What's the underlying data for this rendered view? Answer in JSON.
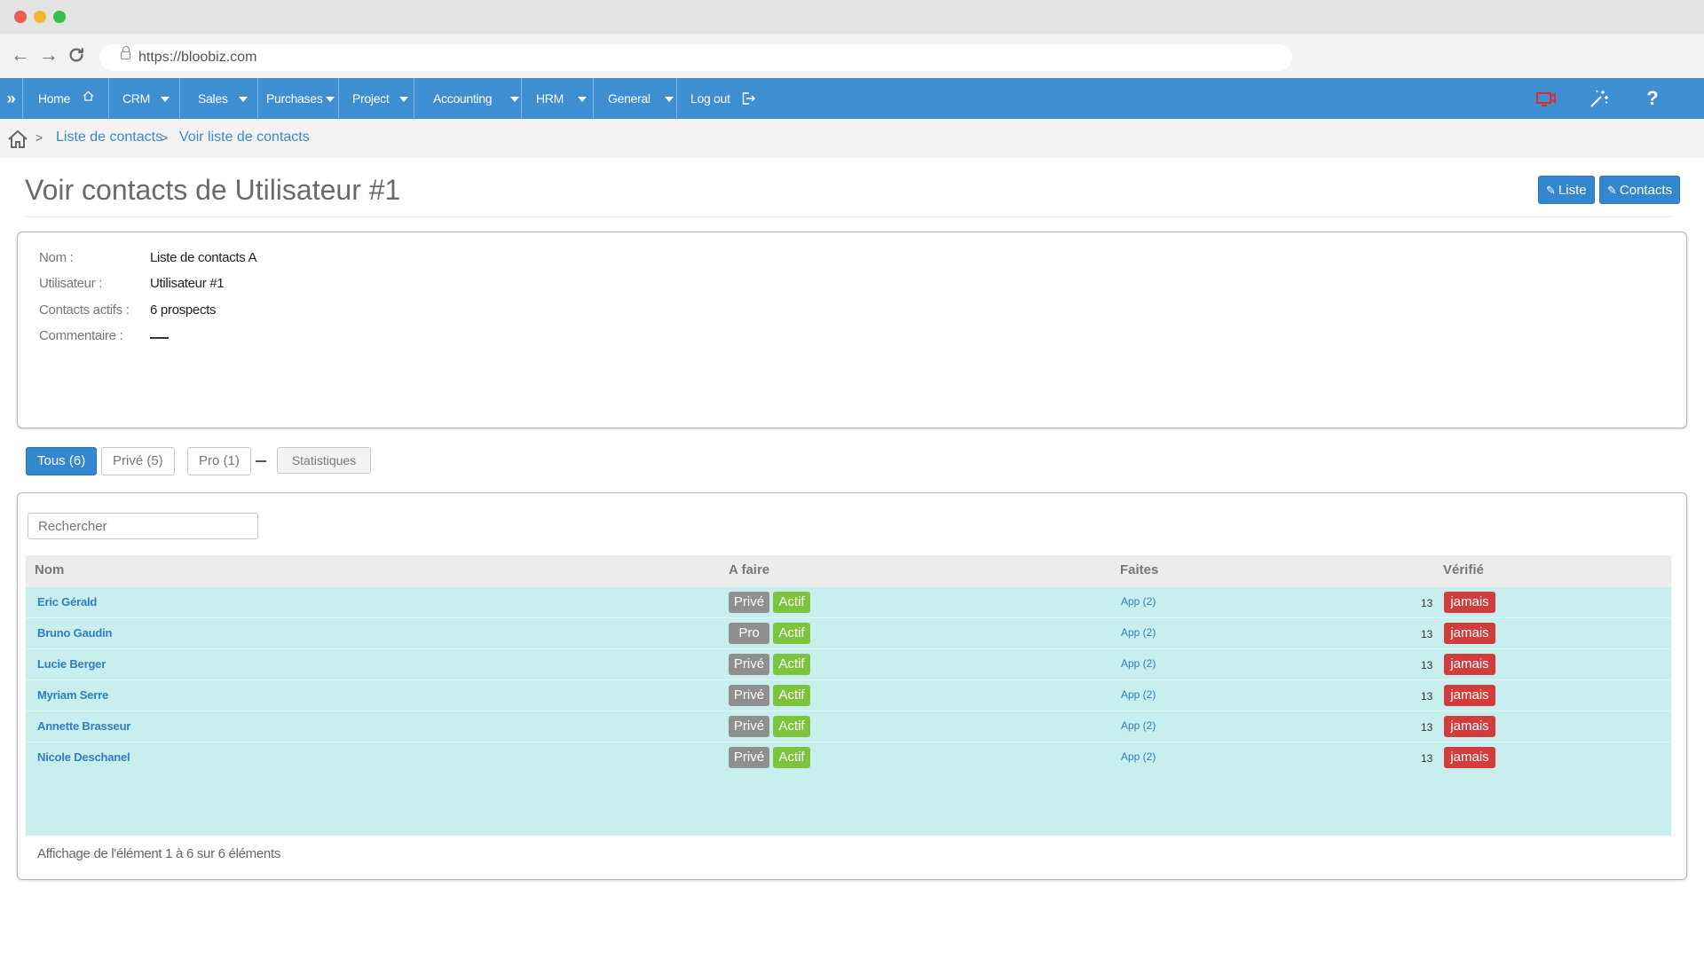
{
  "browser": {
    "url": "https://bloobiz.com"
  },
  "nav": {
    "items": [
      {
        "label": "Home"
      },
      {
        "label": "CRM"
      },
      {
        "label": "Sales"
      },
      {
        "label": "Purchases"
      },
      {
        "label": "Project"
      },
      {
        "label": "Accounting"
      },
      {
        "label": "HRM"
      },
      {
        "label": "General"
      },
      {
        "label": "Log out"
      }
    ],
    "expand_icon": "»",
    "help_label": "?"
  },
  "breadcrumb": {
    "items": [
      "Liste de contacts",
      "Voir liste de contacts"
    ]
  },
  "page": {
    "title": "Voir contacts de Utilisateur #1",
    "buttons": {
      "list_label": "Liste",
      "contacts_label": "Contacts"
    }
  },
  "info": {
    "name_label": "Nom :",
    "name_value": "Liste de contacts A",
    "user_label": "Utilisateur :",
    "user_value": "Utilisateur #1",
    "active_label": "Contacts actifs :",
    "active_value": "6 prospects",
    "comment_label": "Commentaire :"
  },
  "tabs": {
    "all": "Tous (6)",
    "private": "Privé (5)",
    "pro": "Pro (1)",
    "stats": "Statistiques"
  },
  "table": {
    "search_placeholder": "Rechercher",
    "headers": [
      "Nom",
      "A faire",
      "Faites",
      "Vérifié"
    ],
    "rows": [
      {
        "name": "Eric Gérald",
        "type": "Privé",
        "status": "Actif",
        "app": "App (2)",
        "count": "13",
        "verified": "jamais"
      },
      {
        "name": "Bruno Gaudin",
        "type": "Pro",
        "status": "Actif",
        "app": "App (2)",
        "count": "13",
        "verified": "jamais"
      },
      {
        "name": "Lucie Berger",
        "type": "Privé",
        "status": "Actif",
        "app": "App (2)",
        "count": "13",
        "verified": "jamais"
      },
      {
        "name": "Myriam Serre",
        "type": "Privé",
        "status": "Actif",
        "app": "App (2)",
        "count": "13",
        "verified": "jamais"
      },
      {
        "name": "Annette Brasseur",
        "type": "Privé",
        "status": "Actif",
        "app": "App (2)",
        "count": "13",
        "verified": "jamais"
      },
      {
        "name": "Nicole Deschanel",
        "type": "Privé",
        "status": "Actif",
        "app": "App (2)",
        "count": "13",
        "verified": "jamais"
      }
    ],
    "footer": "Affichage de l'élément 1 à 6 sur 6 éléments"
  },
  "colors": {
    "nav_bg": "#3d8fd2",
    "row_bg": "#c8eeed",
    "link": "#2e7fc0",
    "badge_gray": "#8f8f8f",
    "badge_green": "#7cc43c",
    "badge_red": "#d33c3c"
  }
}
